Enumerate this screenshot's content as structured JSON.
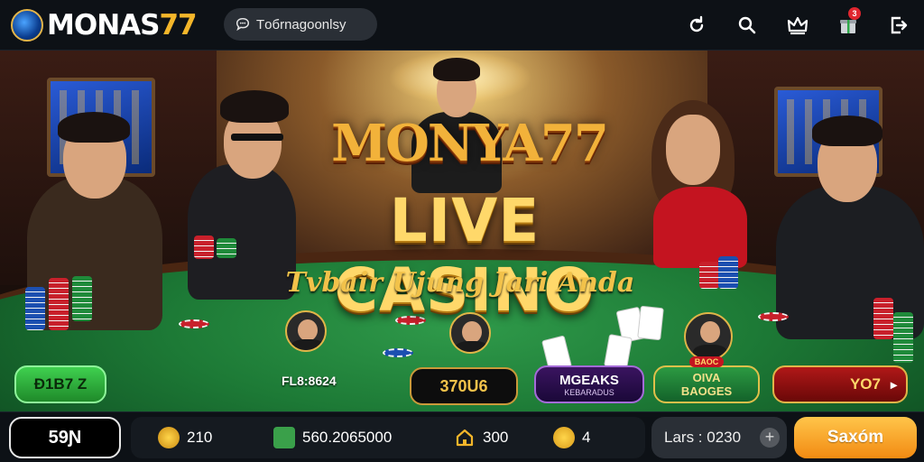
{
  "header": {
    "brand_prefix": "MONAS",
    "brand_suffix": "77",
    "search_label": "Tобrnagoonlsy",
    "icons": [
      "refresh-icon",
      "search-icon",
      "crown-icon",
      "gift-icon",
      "exit-icon"
    ],
    "notification_count": "3"
  },
  "hero": {
    "brand_title": "MONYA77",
    "main_title": "LIVE CASINO",
    "tagline": "Tvbair Ujung Jari Anda",
    "dealer_id": "FL8:8624",
    "buttons": {
      "green": "Ð1B7 Z",
      "dark": "370U6",
      "purple_title": "MGEAKS",
      "purple_sub": "KEBARADUS",
      "green2_title": "OIVA",
      "green2_sub": "BAOGES",
      "green2_badge": "BAOC",
      "red": "YO7"
    }
  },
  "footer": {
    "balance_label": "59Ɲ",
    "stats": [
      {
        "icon": "coin-icon",
        "value": "210"
      },
      {
        "icon": "wallet-icon",
        "value": "560.2065000"
      },
      {
        "icon": "home-icon",
        "value": "300"
      },
      {
        "icon": "token-icon",
        "value": "4"
      }
    ],
    "timer_label": "Lars : 0230",
    "cta_label": "Saxóm"
  },
  "colors": {
    "brand_gold": "#f4b62a",
    "felt_green": "#1d7a36",
    "cta_orange": "#f28a12",
    "dark_bg": "#0d1116"
  }
}
